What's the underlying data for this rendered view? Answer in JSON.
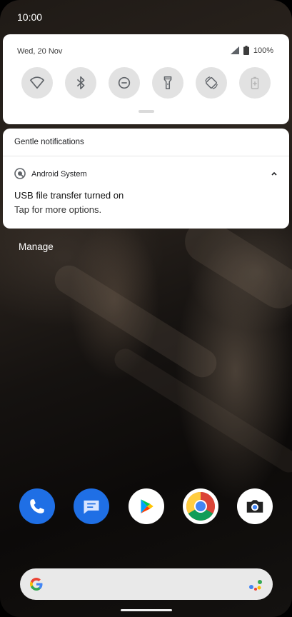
{
  "status_bar": {
    "time": "10:00"
  },
  "quick_settings": {
    "date": "Wed, 20 Nov",
    "battery_percent": "100%",
    "tiles": [
      {
        "name": "wifi",
        "icon": "wifi-icon"
      },
      {
        "name": "bluetooth",
        "icon": "bluetooth-icon"
      },
      {
        "name": "do-not-disturb",
        "icon": "do-not-disturb-icon"
      },
      {
        "name": "flashlight",
        "icon": "flashlight-icon"
      },
      {
        "name": "auto-rotate",
        "icon": "auto-rotate-icon"
      },
      {
        "name": "battery-saver",
        "icon": "battery-saver-icon"
      }
    ]
  },
  "notifications": {
    "section_title": "Gentle notifications",
    "items": [
      {
        "app": "Android System",
        "title": "USB file transfer turned on",
        "text": "Tap for more options."
      }
    ],
    "manage_label": "Manage"
  },
  "dock": {
    "apps": [
      {
        "name": "phone",
        "icon": "phone-icon",
        "color": "#1f6fe5"
      },
      {
        "name": "messages",
        "icon": "messages-icon",
        "color": "#1f6fe5"
      },
      {
        "name": "play-store",
        "icon": "play-store-icon",
        "color": "#ffffff"
      },
      {
        "name": "chrome",
        "icon": "chrome-icon",
        "color": "#ffffff"
      },
      {
        "name": "camera",
        "icon": "camera-icon",
        "color": "#ffffff"
      }
    ]
  },
  "search": {
    "logo": "google-g-icon",
    "assistant": "assistant-icon"
  }
}
